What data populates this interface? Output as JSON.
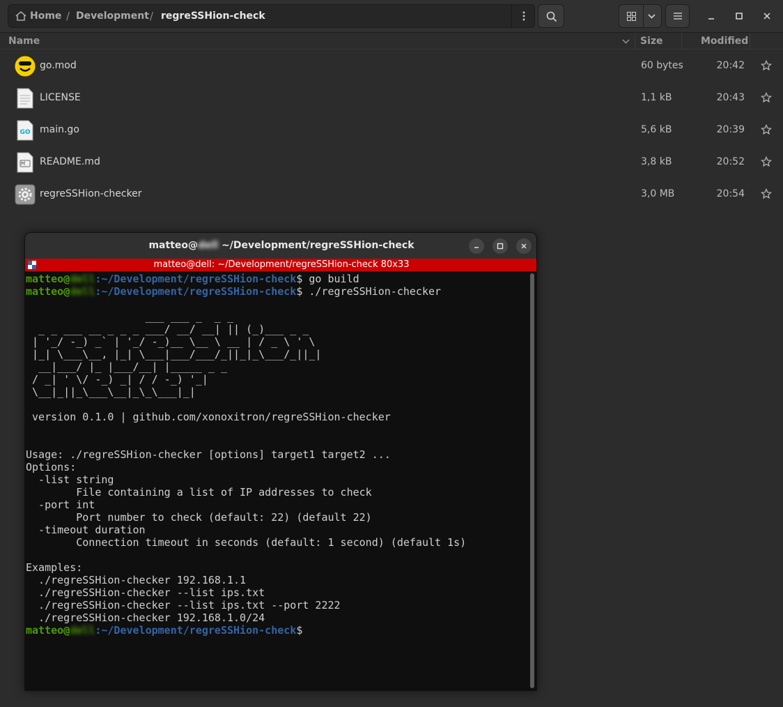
{
  "pathbar": {
    "home": "Home",
    "crumbs": [
      "Development",
      "regreSSHion-check"
    ],
    "separator": "/"
  },
  "columns": {
    "name": "Name",
    "size": "Size",
    "modified": "Modified"
  },
  "files": [
    {
      "name": "go.mod",
      "size": "60 bytes",
      "modified": "20:42",
      "icon": "gopher-icon"
    },
    {
      "name": "LICENSE",
      "size": "1,1 kB",
      "modified": "20:43",
      "icon": "text-file-icon"
    },
    {
      "name": "main.go",
      "size": "5,6 kB",
      "modified": "20:39",
      "icon": "go-file-icon"
    },
    {
      "name": "README.md",
      "size": "3,8 kB",
      "modified": "20:52",
      "icon": "markdown-file-icon"
    },
    {
      "name": "regreSSHion-checker",
      "size": "3,0 MB",
      "modified": "20:54",
      "icon": "executable-gear-icon"
    }
  ],
  "terminal": {
    "title_user": "matteo@",
    "title_host": "dell",
    "title_path": " ~/Development/regreSSHion-check",
    "status_bar": "matteo@dell: ~/Development/regreSSHion-check 80x33",
    "prompt_user": "matteo@",
    "prompt_host": "dell",
    "prompt_path": ":~/Development/regreSSHion-check",
    "prompt_symbol": "$",
    "cmd1": " go build",
    "cmd2": " ./regreSSHion-checker",
    "ascii_art": [
      "                   ___ ___ _  _ _",
      "  _ _ ___ __ _ _ _ ___/ __/ __| || (_)___ _ _",
      " | '_/ -_) _` | '_/ -_)__ \\__ \\ __ | / _ \\ ' \\",
      " |_| \\___\\__, |_| \\___|___/___/_||_|_\\___/_||_|",
      "  __|___/ |_ |___/__| |_____ _ _",
      " / _| ' \\/ -_) _| / / -_) '_|",
      " \\__|_||_\\___\\__|_\\_\\___|_|"
    ],
    "version_line": " version 0.1.0 | github.com/xonoxitron/regreSSHion-checker",
    "usage": "Usage: ./regreSSHion-checker [options] target1 target2 ...",
    "options_header": "Options:",
    "options": [
      "  -list string",
      "        File containing a list of IP addresses to check",
      "  -port int",
      "        Port number to check (default: 22) (default 22)",
      "  -timeout duration",
      "        Connection timeout in seconds (default: 1 second) (default 1s)"
    ],
    "examples_header": "Examples:",
    "examples": [
      "  ./regreSSHion-checker 192.168.1.1",
      "  ./regreSSHion-checker --list ips.txt",
      "  ./regreSSHion-checker --list ips.txt --port 2222",
      "  ./regreSSHion-checker 192.168.1.0/24"
    ]
  },
  "colors": {
    "terminal_status_bar": "#cc0000",
    "prompt_user": "#4e9a06",
    "prompt_path": "#3465a4",
    "window_bg": "#2c2c2c"
  }
}
